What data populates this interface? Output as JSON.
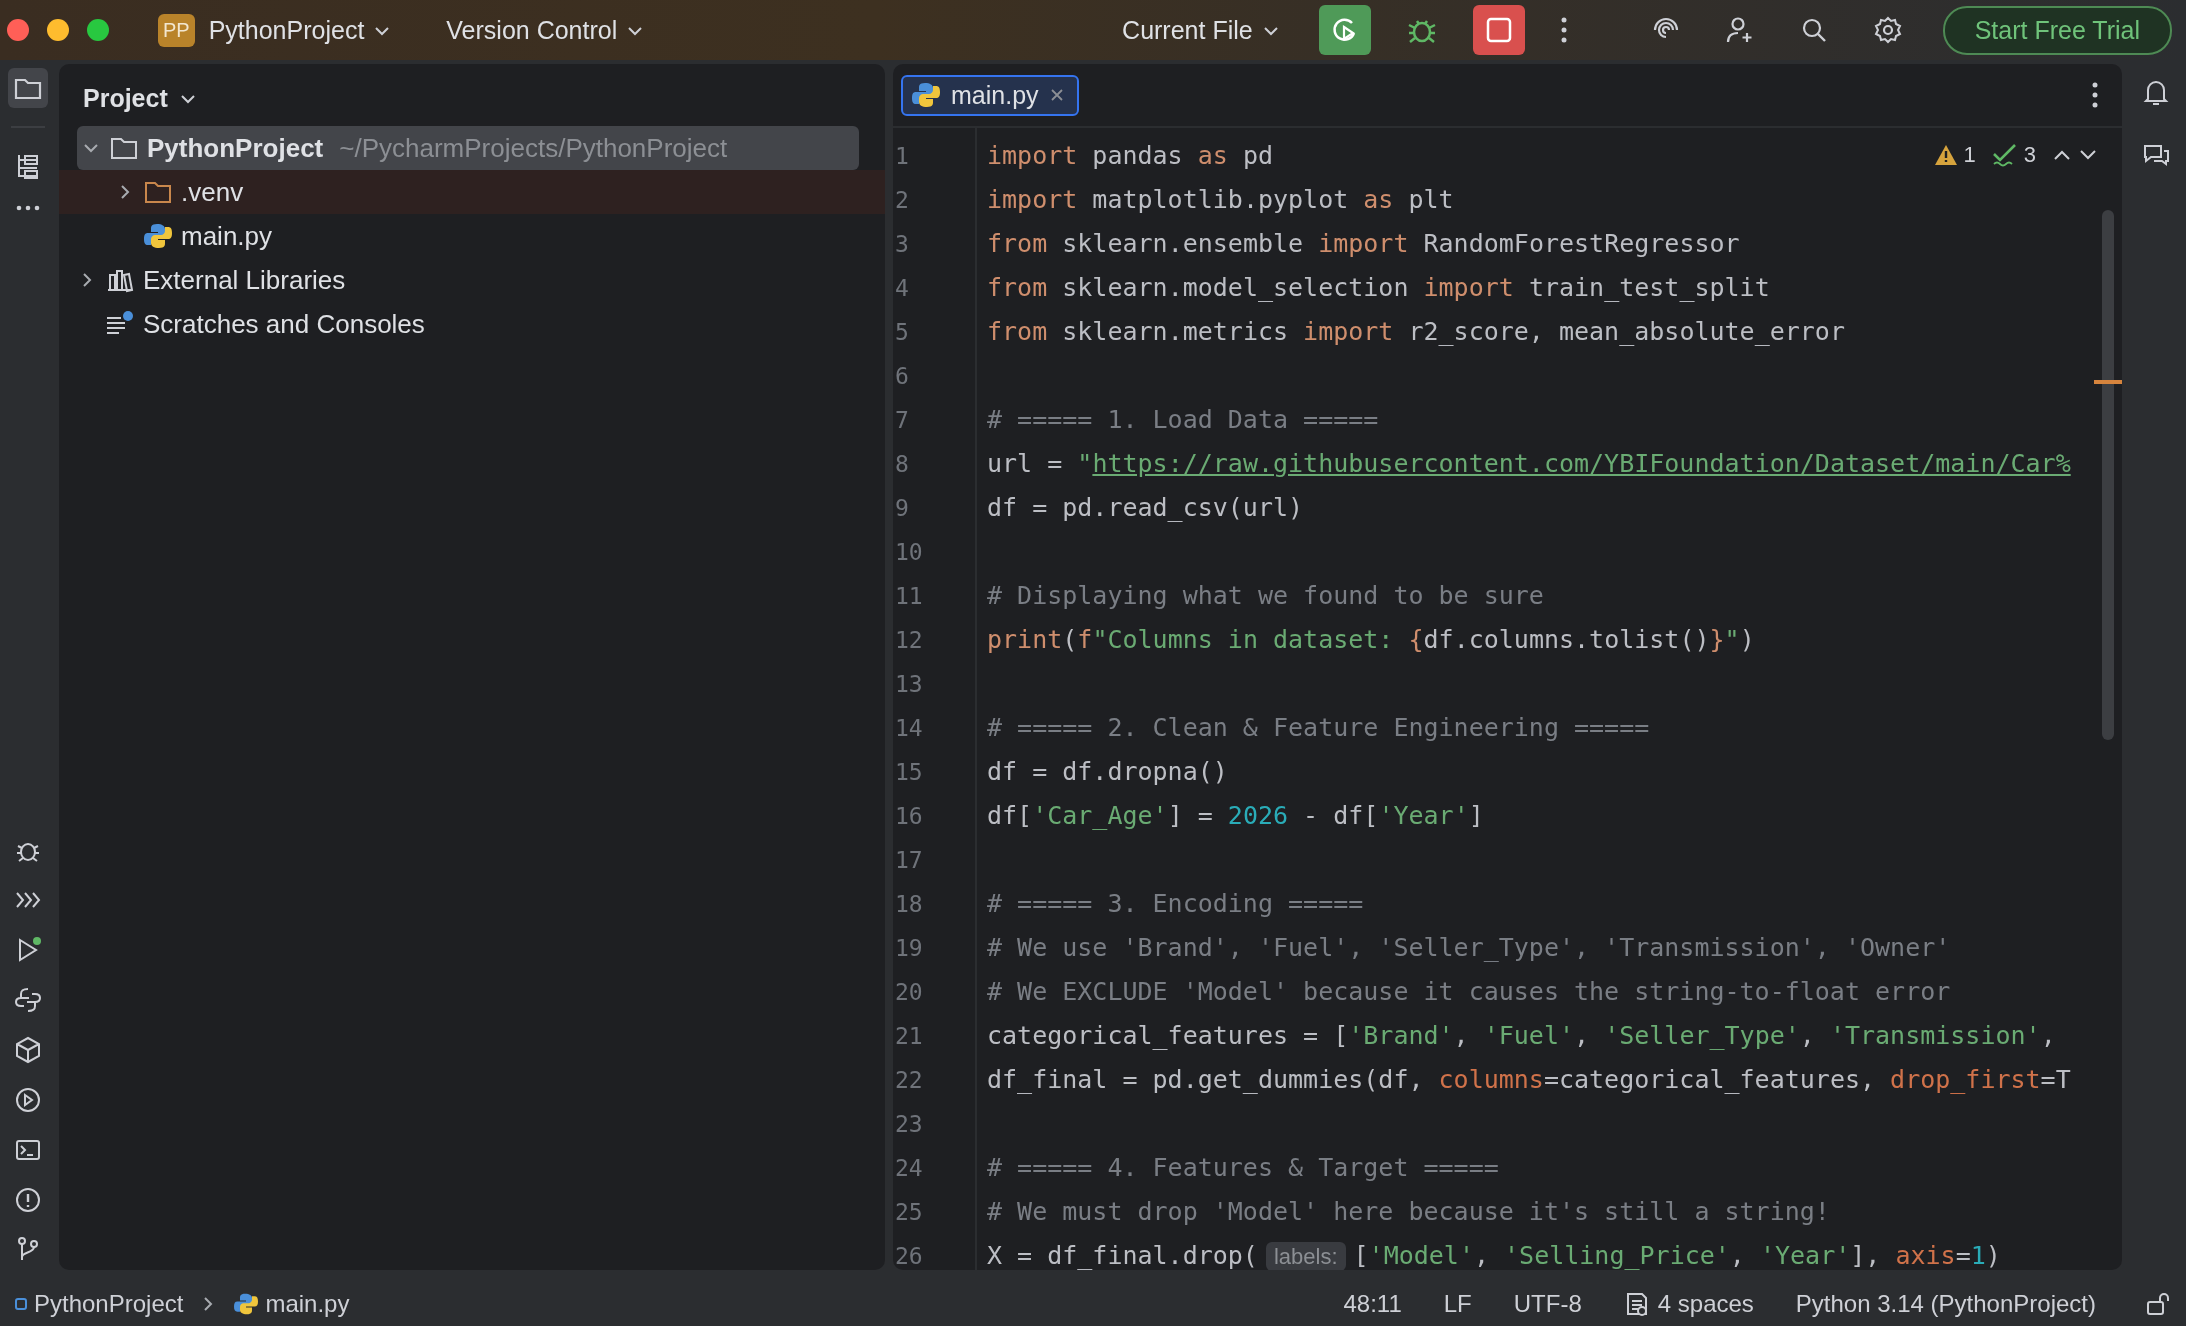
{
  "title_bar": {
    "project_badge": "PP",
    "project": "PythonProject",
    "vcs": "Version Control",
    "run_config": "Current File",
    "trial_button": "Start Free Trial"
  },
  "project_panel": {
    "title": "Project",
    "tree": [
      {
        "label": "PythonProject",
        "path": "~/PycharmProjects/PythonProject",
        "kind": "project",
        "expanded": true,
        "selected": true,
        "children": [
          {
            "label": ".venv",
            "kind": "excluded",
            "expanded": false,
            "selected": false
          },
          {
            "label": "main.py",
            "kind": "python",
            "selected": false
          }
        ]
      },
      {
        "label": "External Libraries",
        "kind": "library",
        "expanded": false,
        "selected": false
      },
      {
        "label": "Scratches and Consoles",
        "kind": "scratches",
        "selected": false
      }
    ]
  },
  "tabs": [
    {
      "label": "main.py",
      "selected": true
    }
  ],
  "inspections": {
    "warnings": "1",
    "checks": "3"
  },
  "code": [
    {
      "n": "1",
      "tokens": [
        {
          "kind": "keyword",
          "t": "import"
        },
        {
          "kind": "plain",
          "t": " pandas "
        },
        {
          "kind": "keyword",
          "t": "as"
        },
        {
          "kind": "plain",
          "t": " pd"
        }
      ]
    },
    {
      "n": "2",
      "tokens": [
        {
          "kind": "keyword",
          "t": "import"
        },
        {
          "kind": "plain",
          "t": " matplotlib.pyplot "
        },
        {
          "kind": "keyword",
          "t": "as"
        },
        {
          "kind": "plain",
          "t": " plt"
        }
      ]
    },
    {
      "n": "3",
      "tokens": [
        {
          "kind": "keyword",
          "t": "from"
        },
        {
          "kind": "plain",
          "t": " sklearn.ensemble "
        },
        {
          "kind": "keyword",
          "t": "import"
        },
        {
          "kind": "plain",
          "t": " RandomForestRegressor"
        }
      ]
    },
    {
      "n": "4",
      "tokens": [
        {
          "kind": "keyword",
          "t": "from"
        },
        {
          "kind": "plain",
          "t": " sklearn.model_selection "
        },
        {
          "kind": "keyword",
          "t": "import"
        },
        {
          "kind": "plain",
          "t": " train_test_split"
        }
      ]
    },
    {
      "n": "5",
      "tokens": [
        {
          "kind": "keyword",
          "t": "from"
        },
        {
          "kind": "plain",
          "t": " sklearn.metrics "
        },
        {
          "kind": "keyword",
          "t": "import"
        },
        {
          "kind": "plain",
          "t": " r2_score, mean_absolute_error"
        }
      ]
    },
    {
      "n": "6"
    },
    {
      "n": "7",
      "tokens": [
        {
          "kind": "comment",
          "t": "# ===== 1. Load Data ====="
        }
      ]
    },
    {
      "n": "8",
      "tokens": [
        {
          "kind": "plain",
          "t": "url = "
        },
        {
          "kind": "string",
          "t": "\""
        },
        {
          "kind": "url",
          "t": "https://raw.githubusercontent.com/YBIFoundation/Dataset/main/Car%"
        }
      ]
    },
    {
      "n": "9",
      "tokens": [
        {
          "kind": "plain",
          "t": "df = pd.read_csv(url)"
        }
      ]
    },
    {
      "n": "10"
    },
    {
      "n": "11",
      "tokens": [
        {
          "kind": "comment",
          "t": "# Displaying what we found to be sure"
        }
      ]
    },
    {
      "n": "12",
      "tokens": [
        {
          "kind": "keyword",
          "t": "print"
        },
        {
          "kind": "plain",
          "t": "("
        },
        {
          "kind": "keyword",
          "t": "f"
        },
        {
          "kind": "string",
          "t": "\"Columns in dataset: "
        },
        {
          "kind": "keyword",
          "t": "{"
        },
        {
          "kind": "plain",
          "t": "df.columns.tolist()"
        },
        {
          "kind": "keyword",
          "t": "}"
        },
        {
          "kind": "string",
          "t": "\""
        },
        {
          "kind": "plain",
          "t": ")"
        }
      ]
    },
    {
      "n": "13"
    },
    {
      "n": "14",
      "tokens": [
        {
          "kind": "comment",
          "t": "# ===== 2. Clean & Feature Engineering ====="
        }
      ]
    },
    {
      "n": "15",
      "tokens": [
        {
          "kind": "plain",
          "t": "df = df.dropna()"
        }
      ]
    },
    {
      "n": "16",
      "tokens": [
        {
          "kind": "plain",
          "t": "df["
        },
        {
          "kind": "string",
          "t": "'Car_Age'"
        },
        {
          "kind": "plain",
          "t": "] = "
        },
        {
          "kind": "number",
          "t": "2026"
        },
        {
          "kind": "plain",
          "t": " - df["
        },
        {
          "kind": "string",
          "t": "'Year'"
        },
        {
          "kind": "plain",
          "t": "]"
        }
      ]
    },
    {
      "n": "17"
    },
    {
      "n": "18",
      "tokens": [
        {
          "kind": "comment",
          "t": "# ===== 3. Encoding ====="
        }
      ]
    },
    {
      "n": "19",
      "tokens": [
        {
          "kind": "comment",
          "t": "# We use 'Brand', 'Fuel', 'Seller_Type', 'Transmission', 'Owner'"
        }
      ]
    },
    {
      "n": "20",
      "tokens": [
        {
          "kind": "comment",
          "t": "# We EXCLUDE 'Model' because it causes the string-to-float error"
        }
      ]
    },
    {
      "n": "21",
      "tokens": [
        {
          "kind": "plain",
          "t": "categorical_features = ["
        },
        {
          "kind": "string",
          "t": "'Brand'"
        },
        {
          "kind": "plain",
          "t": ", "
        },
        {
          "kind": "string",
          "t": "'Fuel'"
        },
        {
          "kind": "plain",
          "t": ", "
        },
        {
          "kind": "string",
          "t": "'Seller_Type'"
        },
        {
          "kind": "plain",
          "t": ", "
        },
        {
          "kind": "string",
          "t": "'Transmission'"
        },
        {
          "kind": "plain",
          "t": ","
        }
      ]
    },
    {
      "n": "22",
      "tokens": [
        {
          "kind": "plain",
          "t": "df_final = pd.get_dummies(df, "
        },
        {
          "kind": "param",
          "t": "columns"
        },
        {
          "kind": "plain",
          "t": "=categorical_features, "
        },
        {
          "kind": "param",
          "t": "drop_first"
        },
        {
          "kind": "plain",
          "t": "=T"
        }
      ]
    },
    {
      "n": "23"
    },
    {
      "n": "24",
      "tokens": [
        {
          "kind": "comment",
          "t": "# ===== 4. Features & Target ====="
        }
      ]
    },
    {
      "n": "25",
      "tokens": [
        {
          "kind": "comment",
          "t": "# We must drop 'Model' here because it's still a string!"
        }
      ]
    },
    {
      "n": "26",
      "tokens": [
        {
          "kind": "plain",
          "t": "X = df_final.drop("
        },
        {
          "kind": "hint",
          "t": "labels:"
        },
        {
          "kind": "plain",
          "t": "["
        },
        {
          "kind": "string",
          "t": "'Model'"
        },
        {
          "kind": "plain",
          "t": ", "
        },
        {
          "kind": "string",
          "t": "'Selling_Price'"
        },
        {
          "kind": "plain",
          "t": ", "
        },
        {
          "kind": "string",
          "t": "'Year'"
        },
        {
          "kind": "plain",
          "t": "], "
        },
        {
          "kind": "param",
          "t": "axis"
        },
        {
          "kind": "plain",
          "t": "="
        },
        {
          "kind": "number",
          "t": "1"
        },
        {
          "kind": "plain",
          "t": ")"
        }
      ]
    }
  ],
  "status_bar": {
    "breadcrumbs": [
      {
        "label": "PythonProject",
        "kind": "module"
      },
      {
        "label": "main.py",
        "kind": "python"
      }
    ],
    "position": "48:11",
    "line_separator": "LF",
    "encoding": "UTF-8",
    "indent": "4 spaces",
    "interpreter": "Python 3.14 (PythonProject)"
  }
}
